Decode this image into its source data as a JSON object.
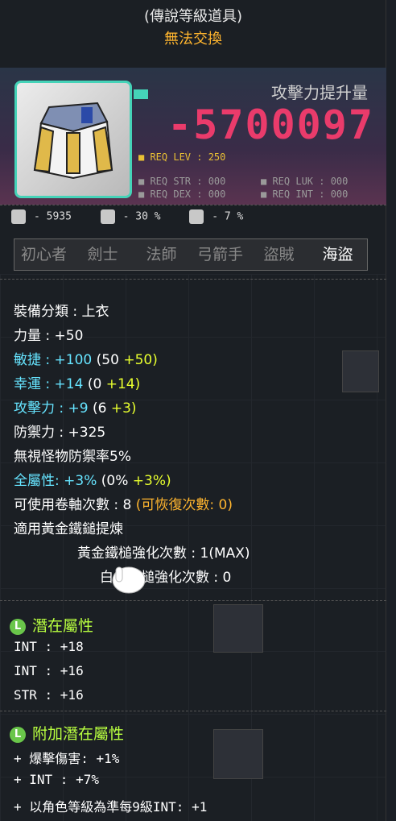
{
  "header": {
    "rarity": "(傳說等級道具)",
    "trade": "無法交換"
  },
  "item": {
    "atk_label": "攻擊力提升量",
    "atk_value": "-5700097",
    "req_lev": "■ REQ LEV : 250",
    "req_str": "■ REQ STR : 000",
    "req_luk": "■ REQ LUK : 000",
    "req_dex": "■ REQ DEX : 000",
    "req_int": "■ REQ INT : 000"
  },
  "stats_row": {
    "s1": "- 5935",
    "s2": "- 30 %",
    "s3": "- 7 %"
  },
  "jobs": [
    "初心者",
    "劍士",
    "法師",
    "弓箭手",
    "盜賊",
    "海盜"
  ],
  "details": {
    "category": "裝備分類 : 上衣",
    "str": "力量 : +50",
    "dex_label": "敏捷 :",
    "dex_total": "+100",
    "dex_base": "(50",
    "dex_bonus": "+50)",
    "luk_label": "幸運 :",
    "luk_total": "+14",
    "luk_base": "(0",
    "luk_bonus": "+14)",
    "atk_label": "攻擊力 :",
    "atk_total": "+9",
    "atk_base": "(6",
    "atk_bonus": "+3)",
    "def": "防禦力 : +325",
    "ignore_def": "無視怪物防禦率5%",
    "allstat_label": "全屬性:",
    "allstat_total": "+3%",
    "allstat_base": "(0%",
    "allstat_bonus": "+3%)",
    "scroll_count": "可使用卷軸次數 : 8",
    "scroll_recover": "(可恢復次數: 0)",
    "golden_hammer": "適用黃金鐵鎚提煉",
    "golden_count": "黃金鐵槌強化次數 : 1(MAX)",
    "white_count": "白金鐵槌強化次數 : 0"
  },
  "potential": {
    "badge": "L",
    "title": "潛在屬性",
    "lines": [
      "INT : +18",
      "INT : +16",
      "STR : +16"
    ]
  },
  "bonus_potential": {
    "badge": "L",
    "title": "附加潛在屬性",
    "lines": [
      "+ 爆擊傷害: +1%",
      "+ INT : +7%",
      "+ 以角色等級為準每9級INT: +1"
    ]
  }
}
